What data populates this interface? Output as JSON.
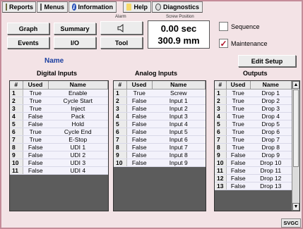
{
  "menu": {
    "tabs": [
      {
        "label": "Reports",
        "icon": "report-icon"
      },
      {
        "label": "Menus",
        "icon": "menus-icon"
      },
      {
        "label": "Information",
        "icon": "info-icon"
      },
      {
        "label": "Help",
        "icon": "help-icon"
      },
      {
        "label": "Diagnostics",
        "icon": "diagnostics-icon"
      }
    ]
  },
  "nav": {
    "graph": "Graph",
    "summary": "Summary",
    "events": "Events",
    "io": "I/O",
    "tool": "Tool",
    "alarm_label": "Alarm",
    "alarm_icon": "speaker-icon"
  },
  "screw": {
    "label": "Screw Position",
    "time": "0.00 sec",
    "position": "300.9 mm"
  },
  "options": {
    "sequence": {
      "label": "Sequence",
      "checked": false
    },
    "maintenance": {
      "label": "Maintenance",
      "checked": true
    }
  },
  "name_label": "Name",
  "edit_setup": "Edit Setup",
  "digital": {
    "title": "Digital Inputs",
    "headers": [
      "#",
      "Used",
      "Name"
    ],
    "rows": [
      [
        "1",
        "True",
        "Enable"
      ],
      [
        "2",
        "True",
        "Cycle Start"
      ],
      [
        "3",
        "True",
        "Inject"
      ],
      [
        "4",
        "False",
        "Pack"
      ],
      [
        "5",
        "False",
        "Hold"
      ],
      [
        "6",
        "True",
        "Cycle End"
      ],
      [
        "7",
        "True",
        "E-Stop"
      ],
      [
        "8",
        "False",
        "UDI 1"
      ],
      [
        "9",
        "False",
        "UDI 2"
      ],
      [
        "10",
        "False",
        "UDI 3"
      ],
      [
        "11",
        "False",
        "UDI 4"
      ]
    ]
  },
  "analog": {
    "title": "Analog Inputs",
    "headers": [
      "#",
      "Used",
      "Name"
    ],
    "rows": [
      [
        "1",
        "True",
        "Screw"
      ],
      [
        "2",
        "False",
        "Input 1"
      ],
      [
        "3",
        "False",
        "Input 2"
      ],
      [
        "4",
        "False",
        "Input 3"
      ],
      [
        "5",
        "False",
        "Input 4"
      ],
      [
        "6",
        "False",
        "Input 5"
      ],
      [
        "7",
        "False",
        "Input 6"
      ],
      [
        "8",
        "False",
        "Input 7"
      ],
      [
        "9",
        "False",
        "Input 8"
      ],
      [
        "10",
        "False",
        "Input 9"
      ]
    ]
  },
  "outputs": {
    "title": "Outputs",
    "headers": [
      "#",
      "Used",
      "Name"
    ],
    "rows": [
      [
        "1",
        "True",
        "Drop 1"
      ],
      [
        "2",
        "True",
        "Drop 2"
      ],
      [
        "3",
        "True",
        "Drop 3"
      ],
      [
        "4",
        "True",
        "Drop 4"
      ],
      [
        "5",
        "True",
        "Drop 5"
      ],
      [
        "6",
        "True",
        "Drop 6"
      ],
      [
        "7",
        "True",
        "Drop 7"
      ],
      [
        "8",
        "True",
        "Drop 8"
      ],
      [
        "9",
        "False",
        "Drop 9"
      ],
      [
        "10",
        "False",
        "Drop 10"
      ],
      [
        "11",
        "False",
        "Drop 11"
      ],
      [
        "12",
        "False",
        "Drop 12"
      ],
      [
        "13",
        "False",
        "Drop 13"
      ]
    ]
  },
  "status": "SVGC",
  "colors": {
    "accent": "#1b3fa0",
    "check": "#b0152a",
    "frame": "#c48c99"
  }
}
